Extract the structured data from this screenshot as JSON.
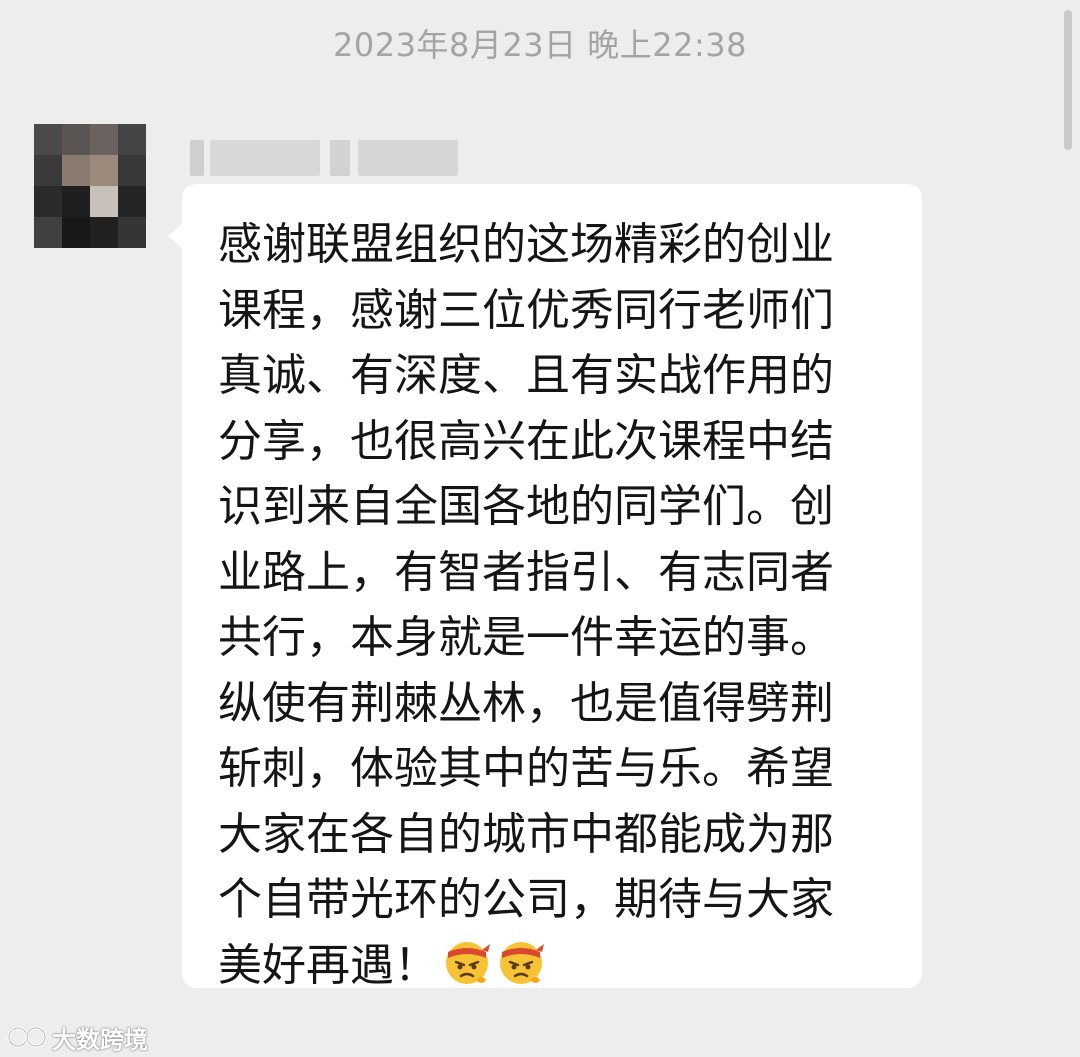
{
  "chat": {
    "timestamp": "2023年8月23日 晚上22:38",
    "message": {
      "sender_name": "",
      "text": "感谢联盟组织的这场精彩的创业\n课程，感谢三位优秀同行老师们\n真诚、有深度、且有实战作用的\n分享，也很高兴在此次课程中结\n识到来自全国各地的同学们。创\n业路上，有智者指引、有志同者\n共行，本身就是一件幸运的事。\n纵使有荆棘丛林，也是值得劈荆\n斩刺，体验其中的苦与乐。希望\n大家在各自的城市中都能成为那\n个自带光环的公司，期待与大家\n美好再遇！",
      "emojis": [
        "determined-face-headband-emoji",
        "determined-face-headband-emoji"
      ]
    }
  },
  "watermark": {
    "text": "大数跨境"
  },
  "colors": {
    "background": "#ededed",
    "bubble": "#ffffff",
    "timestamp_text": "#a4a4a4",
    "message_text": "#151515"
  }
}
